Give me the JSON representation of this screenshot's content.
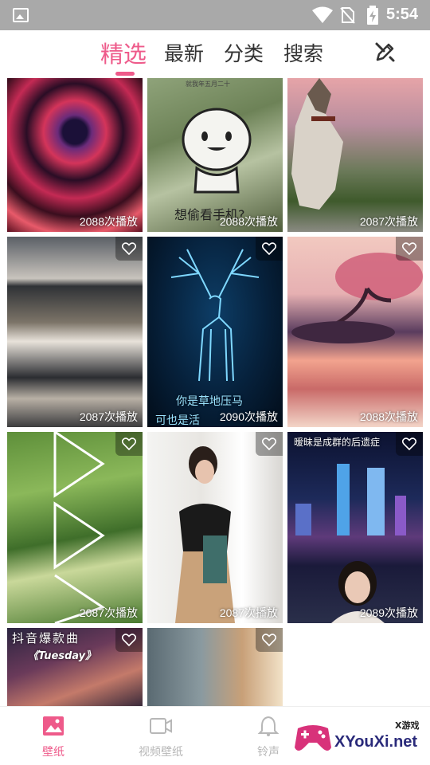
{
  "status_bar": {
    "time": "5:54"
  },
  "top_nav": {
    "tabs": [
      {
        "label": "精选",
        "active": true
      },
      {
        "label": "最新",
        "active": false
      },
      {
        "label": "分类",
        "active": false
      },
      {
        "label": "搜索",
        "active": false
      }
    ],
    "accent_color": "#ee5a8a"
  },
  "tiles": [
    {
      "plays": "2088次播放",
      "favorite": false
    },
    {
      "plays": "2088次播放",
      "favorite": false,
      "text_top": "就我年五月二十",
      "text_bottom": "想偷看手机?"
    },
    {
      "plays": "2087次播放",
      "favorite": false
    },
    {
      "plays": "2087次播放",
      "favorite": true
    },
    {
      "plays": "2090次播放",
      "favorite": true,
      "text_bottom": "你是草地压马",
      "text_bottom2": "可也是活"
    },
    {
      "plays": "2088次播放",
      "favorite": true
    },
    {
      "plays": "2087次播放",
      "favorite": true
    },
    {
      "plays": "2087次播放",
      "favorite": true
    },
    {
      "plays": "2089次播放",
      "favorite": true,
      "text_top": "暧昧是成群的后遗症"
    },
    {
      "plays": "",
      "favorite": true,
      "text_top": "抖音爆款曲",
      "text_top2": "《Tuesday》"
    },
    {
      "plays": "",
      "favorite": true
    }
  ],
  "bottom_nav": {
    "items": [
      {
        "label": "壁纸",
        "icon": "wallpaper-icon",
        "active": true
      },
      {
        "label": "视频壁纸",
        "icon": "video-icon",
        "active": false
      },
      {
        "label": "铃声",
        "icon": "bell-icon",
        "active": false
      }
    ]
  },
  "watermark": {
    "brand": "XYouXi.net",
    "small": "X游戏"
  }
}
